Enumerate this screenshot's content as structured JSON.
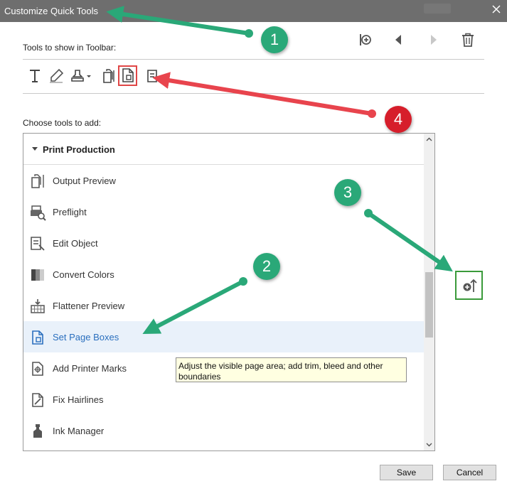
{
  "window": {
    "title": "Customize Quick Tools"
  },
  "labels": {
    "toolbar_section": "Tools to show in Toolbar:",
    "choose_section": "Choose tools to add:"
  },
  "header_icons": [
    "add-divider-icon",
    "move-left-icon",
    "move-right-icon",
    "trash-icon"
  ],
  "toolbar_icons": [
    "text-icon",
    "highlight-pen-icon",
    "stamp-icon",
    "output-preview-icon",
    "set-page-boxes-icon",
    "edit-object-icon"
  ],
  "tool_group": {
    "title": "Print Production",
    "items": [
      {
        "label": "Output Preview",
        "icon": "output-preview-icon"
      },
      {
        "label": "Preflight",
        "icon": "preflight-icon"
      },
      {
        "label": "Edit Object",
        "icon": "edit-object-icon"
      },
      {
        "label": "Convert Colors",
        "icon": "convert-colors-icon"
      },
      {
        "label": "Flattener Preview",
        "icon": "flattener-preview-icon"
      },
      {
        "label": "Set Page Boxes",
        "icon": "set-page-boxes-icon",
        "selected": true
      },
      {
        "label": "Add Printer Marks",
        "icon": "printer-marks-icon"
      },
      {
        "label": "Fix Hairlines",
        "icon": "fix-hairlines-icon"
      },
      {
        "label": "Ink Manager",
        "icon": "ink-manager-icon"
      }
    ]
  },
  "tooltip": {
    "text": "Adjust the visible page area; add trim, bleed and other boundaries"
  },
  "buttons": {
    "save": "Save",
    "cancel": "Cancel"
  },
  "annotations": {
    "badge_1": "1",
    "badge_2": "2",
    "badge_3": "3",
    "badge_4": "4"
  },
  "colors": {
    "titlebar": "#6e6e6e",
    "selected_row": "#e9f1fa",
    "selected_text": "#2a6fbe",
    "arrow_green": "#2aa878",
    "arrow_red": "#e8444d",
    "highlight_red": "#e04646",
    "highlight_green": "#3a9a3a"
  }
}
